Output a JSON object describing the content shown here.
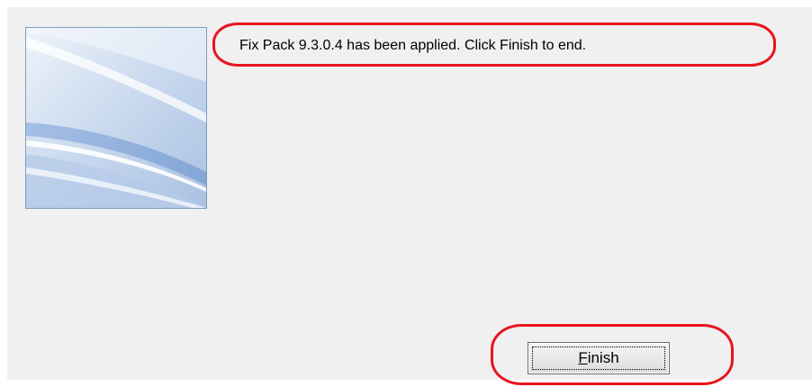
{
  "dialog": {
    "message": "Fix Pack 9.3.0.4 has been applied. Click Finish to end.",
    "banner_icon": "decorative-wave-banner",
    "finish_button": {
      "mnemonic": "F",
      "rest": "inish"
    }
  },
  "annotations": {
    "color": "#e8141e"
  }
}
